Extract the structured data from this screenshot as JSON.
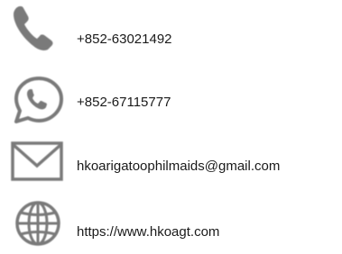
{
  "contacts": [
    {
      "type": "phone",
      "icon": "phone-icon",
      "text": "+852-63021492"
    },
    {
      "type": "whatsapp",
      "icon": "whatsapp-icon",
      "text": "+852-67115777"
    },
    {
      "type": "email",
      "icon": "envelope-icon",
      "text": "hkoarigatoophilmaids@gmail.com"
    },
    {
      "type": "website",
      "icon": "globe-icon",
      "text": "https://www.hkoagt.com"
    }
  ],
  "colors": {
    "icon": "#7a7a7a",
    "text": "#1a1a1a",
    "background": "#ffffff"
  }
}
